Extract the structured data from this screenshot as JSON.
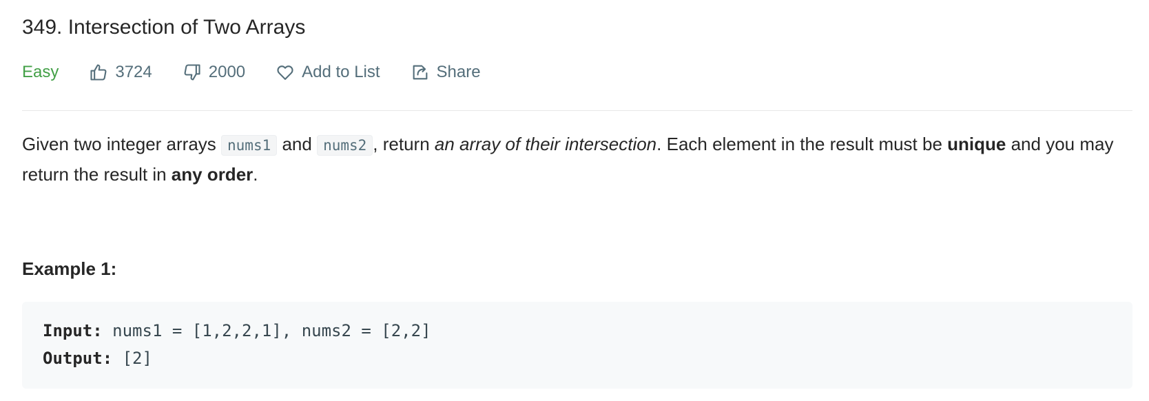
{
  "problem": {
    "title": "349. Intersection of Two Arrays",
    "difficulty": "Easy",
    "likes": "3724",
    "dislikes": "2000",
    "add_to_list_label": "Add to List",
    "share_label": "Share"
  },
  "description": {
    "text1": "Given two integer arrays ",
    "code1": "nums1",
    "text2": " and ",
    "code2": "nums2",
    "text3": ", return ",
    "italic": "an array of their intersection",
    "text4": ". Each element in the result must be ",
    "bold1": "unique",
    "text5": " and you may return the result in ",
    "bold2": "any order",
    "text6": "."
  },
  "example1": {
    "heading": "Example 1:",
    "input_label": "Input:",
    "input_value": " nums1 = [1,2,2,1], nums2 = [2,2]",
    "output_label": "Output:",
    "output_value": " [2]"
  },
  "colors": {
    "difficulty_easy": "#43a047",
    "meta_text": "#546e7a",
    "example_bg": "#f7f9fa"
  }
}
